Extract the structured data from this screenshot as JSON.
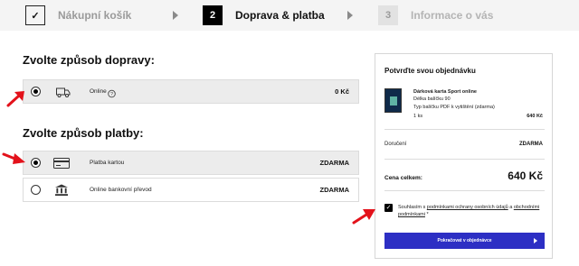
{
  "stepper": {
    "steps": [
      {
        "number": "✓",
        "label": "Nákupní košík"
      },
      {
        "number": "2",
        "label": "Doprava & platba"
      },
      {
        "number": "3",
        "label": "Informace o vás"
      }
    ]
  },
  "shipping": {
    "title": "Zvolte způsob dopravy:",
    "options": [
      {
        "label": "Online",
        "price": "0 Kč",
        "selected": true,
        "icon": "truck-icon"
      }
    ]
  },
  "payment": {
    "title": "Zvolte způsob platby:",
    "options": [
      {
        "label": "Platba kartou",
        "price": "ZDARMA",
        "selected": true,
        "icon": "card-icon"
      },
      {
        "label": "Online bankovní převod",
        "price": "ZDARMA",
        "selected": false,
        "icon": "bank-icon"
      }
    ]
  },
  "summary": {
    "title": "Potvrďte svou objednávku",
    "product": {
      "name": "Dárková karta Sport online",
      "length": "Délka balíčku 90",
      "type": "Typ balíčku PDF k vytištění (zdarma)",
      "qty": "1 ks",
      "price": "640 Kč"
    },
    "delivery_label": "Doručení",
    "delivery_value": "ZDARMA",
    "total_label": "Cena celkem:",
    "total_value": "640 Kč",
    "consent": {
      "prefix": "Souhlasím s",
      "link1": "podmínkami ochrany osobních údajů",
      "middle": "a",
      "link2": "obchodními podmínkami",
      "suffix": "*"
    },
    "cta_label": "Pokračovat v objednávce"
  },
  "colors": {
    "accent": "#2d2fc4",
    "annotation": "#e3121b",
    "selected_row": "#ececec"
  }
}
